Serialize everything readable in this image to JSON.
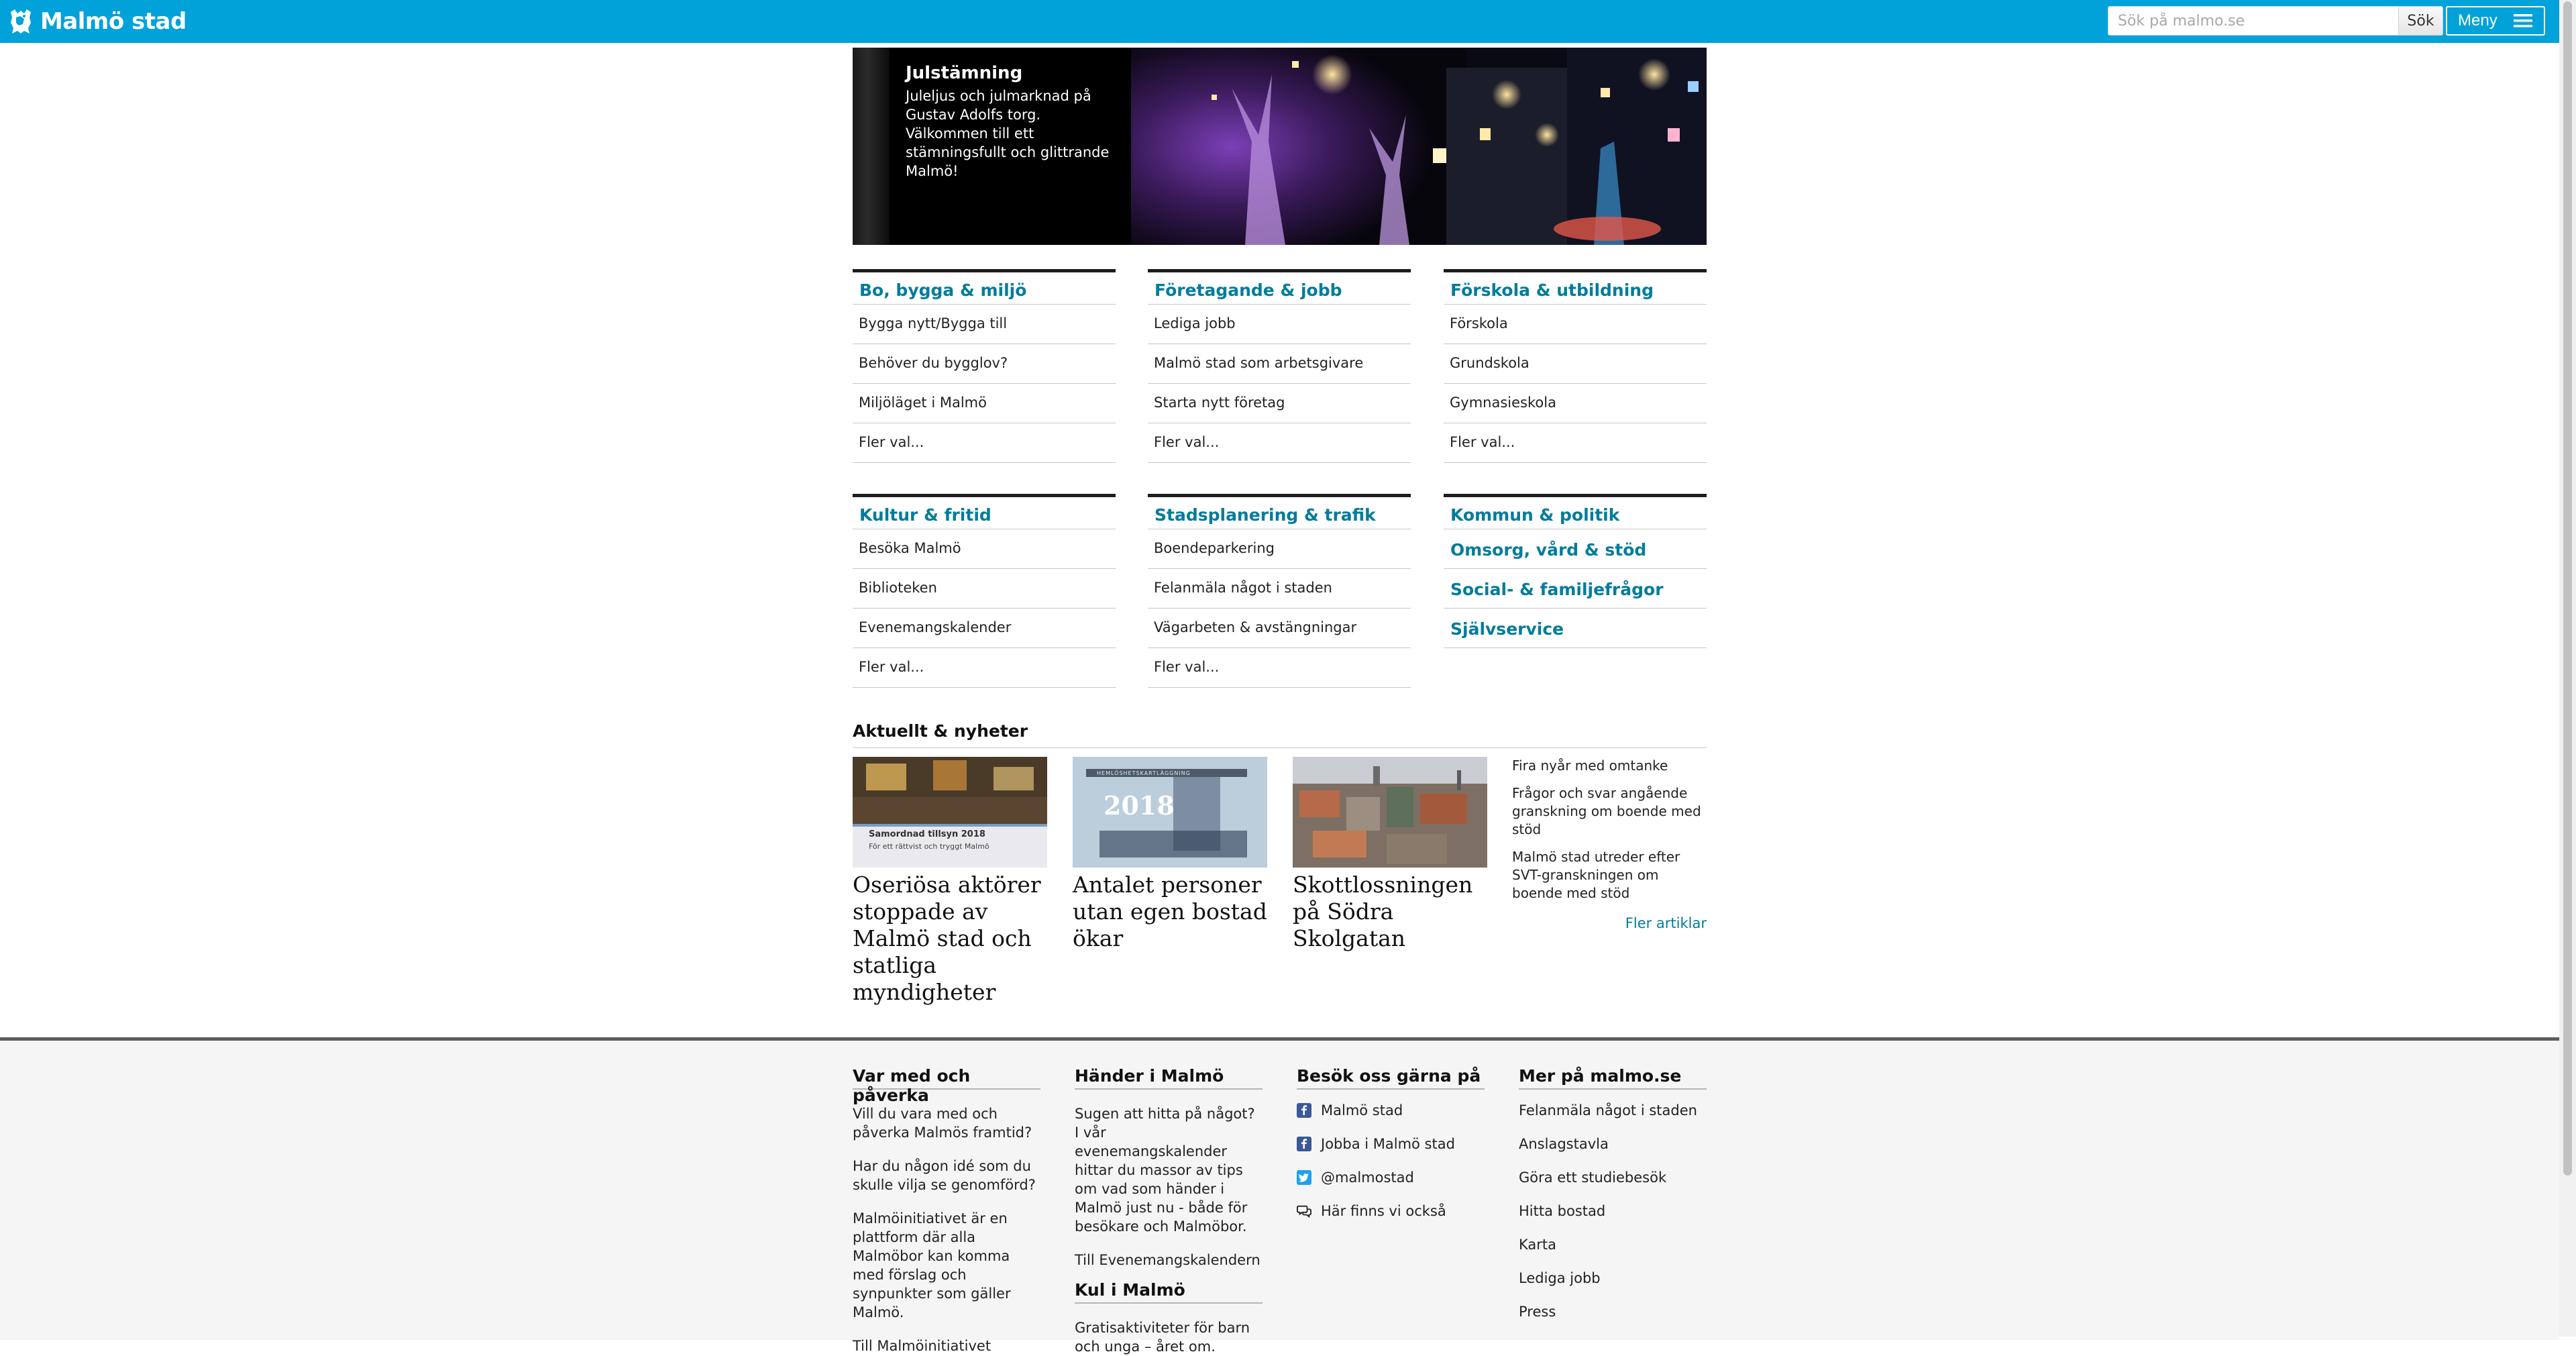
{
  "header": {
    "logo_text": "Malmö stad",
    "search_placeholder": "Sök på malmo.se",
    "search_button": "Sök",
    "menu_label": "Meny"
  },
  "hero": {
    "title": "Julstämning",
    "body": "Juleljus och julmarknad på Gustav Adolfs torg. Välkommen till ett stämningsfullt och glittrande Malmö!"
  },
  "categories": [
    {
      "title": "Bo, bygga & miljö",
      "items": [
        "Bygga nytt/Bygga till",
        "Behöver du bygglov?",
        "Miljöläget i Malmö",
        "Fler val..."
      ]
    },
    {
      "title": "Företagande & jobb",
      "items": [
        "Lediga jobb",
        "Malmö stad som arbetsgivare",
        "Starta nytt företag",
        "Fler val..."
      ]
    },
    {
      "title": "Förskola & utbildning",
      "items": [
        "Förskola",
        "Grundskola",
        "Gymnasieskola",
        "Fler val..."
      ]
    },
    {
      "title": "Kultur & fritid",
      "items": [
        "Besöka Malmö",
        "Biblioteken",
        "Evenemangskalender",
        "Fler val..."
      ]
    },
    {
      "title": "Stadsplanering & trafik",
      "items": [
        "Boendeparkering",
        "Felanmäla något i staden",
        "Vägarbeten & avstängningar",
        "Fler val..."
      ]
    }
  ],
  "extra_links": [
    "Kommun & politik",
    "Omsorg, vård & stöd",
    "Social- & familjefrågor",
    "Självservice"
  ],
  "news": {
    "heading": "Aktuellt & nyheter",
    "cards": [
      {
        "title": "Oseriösa aktörer stoppade av Malmö stad och statliga myndigheter",
        "image_caption_1": "Samordnad tillsyn 2018",
        "image_caption_2": "För ett rättvist och tryggt Malmö"
      },
      {
        "title": "Antalet personer utan egen bostad ökar",
        "image_caption_1": "2018",
        "image_caption_2": "HEMLÖSHETSKARTLÄGGNING"
      },
      {
        "title": "Skottlossningen på Södra Skolgatan"
      }
    ],
    "list": [
      "Fira nyår med omtanke",
      "Frågor och svar angående granskning om boende med stöd",
      "Malmö stad utreder efter SVT-granskningen om boende med stöd"
    ],
    "more": "Fler artiklar"
  },
  "footer": {
    "col1": {
      "heading": "Var med och påverka",
      "paragraphs": [
        "Vill du vara med och påverka Malmös framtid?",
        "Har du någon idé som du skulle vilja se genomförd?",
        "Malmöinitiativet är en plattform där alla Malmöbor kan komma med förslag och synpunkter som gäller Malmö.",
        "Till Malmöinitiativet"
      ]
    },
    "col2": {
      "heading": "Händer i Malmö",
      "paragraph": "Sugen att hitta på något? I vår evenemangskalender hittar du massor av tips om vad som händer i Malmö just nu - både för besökare och Malmöbor.",
      "link": "Till Evenemangskalendern",
      "heading2": "Kul i Malmö",
      "paragraph2": "Gratisaktiviteter för barn och unga – året om."
    },
    "col3": {
      "heading": "Besök oss gärna på",
      "links": [
        {
          "label": "Malmö stad",
          "icon": "facebook-icon"
        },
        {
          "label": "Jobba i Malmö stad",
          "icon": "facebook-icon"
        },
        {
          "label": "@malmostad",
          "icon": "twitter-icon"
        },
        {
          "label": "Här finns vi också",
          "icon": "chat-icon"
        }
      ]
    },
    "col4": {
      "heading": "Mer på malmo.se",
      "links": [
        "Felanmäla något i staden",
        "Anslagstavla",
        "Göra ett studiebesök",
        "Hitta bostad",
        "Karta",
        "Lediga jobb",
        "Press"
      ]
    }
  },
  "colors": {
    "topbar": "#00a2d9",
    "link": "#007c9c",
    "footer_bg": "#f5f5f5"
  }
}
